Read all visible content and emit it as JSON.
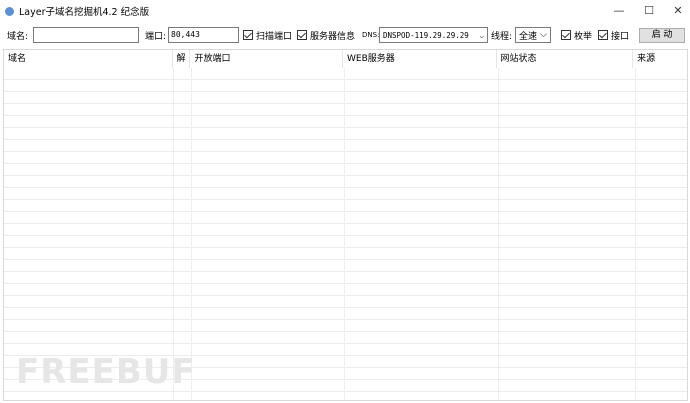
{
  "window": {
    "title": "Layer子域名挖掘机4.2 纪念版",
    "minimize": "—",
    "maximize": "☐",
    "close": "✕"
  },
  "toolbar": {
    "domain_label": "域名:",
    "domain_value": "",
    "port_label": "端口:",
    "port_value": "80,443",
    "scan_port": "扫描端口",
    "server_info": "服务器信息",
    "dns_label": "DNS:",
    "dns_value": "DNSPOD-119.29.29.29",
    "thread_label": "线程:",
    "thread_value": "全速",
    "enumerate": "枚举",
    "api": "接口",
    "start": "启 动"
  },
  "table": {
    "columns": [
      "域名",
      "解",
      "开放端口",
      "WEB服务器",
      "网站状态",
      "来源"
    ]
  },
  "watermark": "FREEBUF"
}
